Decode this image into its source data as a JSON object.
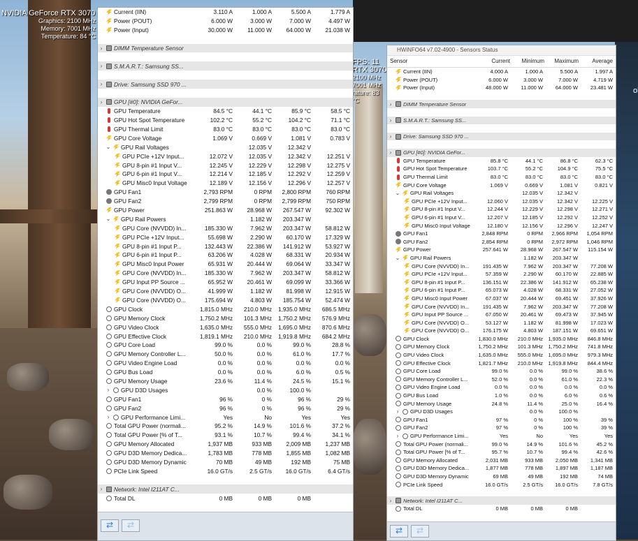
{
  "overlay": {
    "gpu_name": "NVIDIA GeForce RTX 3070",
    "graphics": "Graphics: 2100 MHz",
    "memory": "Memory: 7001 MHz",
    "temperature": "Temperature: 84 °C",
    "fps": "FPS: 11",
    "fps_gpu": "RTX 3070",
    "fps_line1": "2100 MHz",
    "fps_line2": "7001 MHz",
    "fps_line3": "rature: 83 °C",
    "right_text": "ol"
  },
  "win2": {
    "title": "HWiNFO64 v7.02-4900 - Sensors Status",
    "headers": [
      "Sensor",
      "Current",
      "Minimum",
      "Maximum",
      "Average"
    ]
  },
  "win1_rows": [
    {
      "t": "power",
      "n": "Current (IIN)",
      "c": "3.110 A",
      "mi": "1.000 A",
      "ma": "5.500 A",
      "av": "1.779 A"
    },
    {
      "t": "power",
      "n": "Power (POUT)",
      "c": "6.000 W",
      "mi": "3.000 W",
      "ma": "7.000 W",
      "av": "4.497 W"
    },
    {
      "t": "power",
      "n": "Power (Input)",
      "c": "30.000 W",
      "mi": "11.000 W",
      "ma": "64.000 W",
      "av": "21.038 W"
    },
    {
      "t": "gap"
    },
    {
      "t": "grp",
      "n": "DIMM Temperature Sensor"
    },
    {
      "t": "gap"
    },
    {
      "t": "grp",
      "n": "S.M.A.R.T.: Samsung SS..."
    },
    {
      "t": "gap"
    },
    {
      "t": "grp",
      "n": "Drive: Samsung SSD 970 ..."
    },
    {
      "t": "gap"
    },
    {
      "t": "grp",
      "n": "GPU [#0]: NVIDIA GeFor...",
      "open": true
    },
    {
      "t": "temp",
      "n": "GPU Temperature",
      "c": "84.5 °C",
      "mi": "44.1 °C",
      "ma": "85.9 °C",
      "av": "58.5 °C"
    },
    {
      "t": "temp",
      "n": "GPU Hot Spot Temperature",
      "c": "102.2 °C",
      "mi": "55.2 °C",
      "ma": "104.2 °C",
      "av": "71.1 °C"
    },
    {
      "t": "temp",
      "n": "GPU Thermal Limit",
      "c": "83.0 °C",
      "mi": "83.0 °C",
      "ma": "83.0 °C",
      "av": "83.0 °C"
    },
    {
      "t": "power",
      "n": "GPU Core Voltage",
      "c": "1.069 V",
      "mi": "0.669 V",
      "ma": "1.081 V",
      "av": "0.783 V"
    },
    {
      "t": "power",
      "n": "GPU Rail Voltages",
      "sub": 1,
      "tw": true,
      "c": "",
      "mi": "12.035 V",
      "ma": "12.342 V",
      "av": ""
    },
    {
      "t": "power",
      "n": "GPU PCIe +12V Input...",
      "sub": 2,
      "c": "12.072 V",
      "mi": "12.035 V",
      "ma": "12.342 V",
      "av": "12.251 V"
    },
    {
      "t": "power",
      "n": "GPU 8-pin #1 Input V...",
      "sub": 2,
      "c": "12.245 V",
      "mi": "12.229 V",
      "ma": "12.298 V",
      "av": "12.275 V"
    },
    {
      "t": "power",
      "n": "GPU 6-pin #1 Input V...",
      "sub": 2,
      "c": "12.214 V",
      "mi": "12.185 V",
      "ma": "12.292 V",
      "av": "12.259 V"
    },
    {
      "t": "power",
      "n": "GPU Misc0 Input Voltage",
      "sub": 2,
      "c": "12.189 V",
      "mi": "12.156 V",
      "ma": "12.296 V",
      "av": "12.257 V"
    },
    {
      "t": "fan",
      "n": "GPU Fan1",
      "c": "2,793 RPM",
      "mi": "0 RPM",
      "ma": "2,800 RPM",
      "av": "760 RPM"
    },
    {
      "t": "fan",
      "n": "GPU Fan2",
      "c": "2,799 RPM",
      "mi": "0 RPM",
      "ma": "2,799 RPM",
      "av": "750 RPM"
    },
    {
      "t": "power",
      "n": "GPU Power",
      "c": "251.863 W",
      "mi": "28.968 W",
      "ma": "267.547 W",
      "av": "92.302 W"
    },
    {
      "t": "power",
      "n": "GPU Rail Powers",
      "sub": 1,
      "tw": true,
      "c": "",
      "mi": "1.182 W",
      "ma": "203.347 W",
      "av": ""
    },
    {
      "t": "power",
      "n": "GPU Core (NVVDD) In...",
      "sub": 2,
      "c": "185.330 W",
      "mi": "7.962 W",
      "ma": "203.347 W",
      "av": "58.812 W"
    },
    {
      "t": "power",
      "n": "GPU PCIe +12V Input...",
      "sub": 2,
      "c": "55.698 W",
      "mi": "2.290 W",
      "ma": "60.170 W",
      "av": "17.329 W"
    },
    {
      "t": "power",
      "n": "GPU 8-pin #1 Input P...",
      "sub": 2,
      "c": "132.443 W",
      "mi": "22.386 W",
      "ma": "141.912 W",
      "av": "53.927 W"
    },
    {
      "t": "power",
      "n": "GPU 6-pin #1 Input P...",
      "sub": 2,
      "c": "63.206 W",
      "mi": "4.028 W",
      "ma": "68.331 W",
      "av": "20.934 W"
    },
    {
      "t": "power",
      "n": "GPU Misc0 Input Power",
      "sub": 2,
      "c": "65.931 W",
      "mi": "20.444 W",
      "ma": "69.064 W",
      "av": "33.347 W"
    },
    {
      "t": "power",
      "n": "GPU Core (NVVDD) In...",
      "sub": 2,
      "c": "185.330 W",
      "mi": "7.962 W",
      "ma": "203.347 W",
      "av": "58.812 W"
    },
    {
      "t": "power",
      "n": "GPU Input PP Source ...",
      "sub": 2,
      "c": "65.952 W",
      "mi": "20.461 W",
      "ma": "69.099 W",
      "av": "33.366 W"
    },
    {
      "t": "power",
      "n": "GPU Core (NVVDD) O...",
      "sub": 2,
      "c": "41.999 W",
      "mi": "1.182 W",
      "ma": "81.998 W",
      "av": "12.915 W"
    },
    {
      "t": "power",
      "n": "GPU Core (NVVDD) O...",
      "sub": 2,
      "c": "175.694 W",
      "mi": "4.803 W",
      "ma": "185.754 W",
      "av": "52.474 W"
    },
    {
      "t": "clock",
      "n": "GPU Clock",
      "c": "1,815.0 MHz",
      "mi": "210.0 MHz",
      "ma": "1,935.0 MHz",
      "av": "686.5 MHz"
    },
    {
      "t": "clock",
      "n": "GPU Memory Clock",
      "c": "1,750.2 MHz",
      "mi": "101.3 MHz",
      "ma": "1,750.2 MHz",
      "av": "576.9 MHz"
    },
    {
      "t": "clock",
      "n": "GPU Video Clock",
      "c": "1,635.0 MHz",
      "mi": "555.0 MHz",
      "ma": "1,695.0 MHz",
      "av": "870.6 MHz"
    },
    {
      "t": "clock",
      "n": "GPU Effective Clock",
      "c": "1,819.1 MHz",
      "mi": "210.0 MHz",
      "ma": "1,919.8 MHz",
      "av": "684.2 MHz"
    },
    {
      "t": "clock",
      "n": "GPU Core Load",
      "c": "99.0 %",
      "mi": "0.0 %",
      "ma": "99.0 %",
      "av": "28.8 %"
    },
    {
      "t": "clock",
      "n": "GPU Memory Controller L...",
      "c": "50.0 %",
      "mi": "0.0 %",
      "ma": "61.0 %",
      "av": "17.7 %"
    },
    {
      "t": "clock",
      "n": "GPU Video Engine Load",
      "c": "0.0 %",
      "mi": "0.0 %",
      "ma": "0.0 %",
      "av": "0.0 %"
    },
    {
      "t": "clock",
      "n": "GPU Bus Load",
      "c": "0.0 %",
      "mi": "0.0 %",
      "ma": "6.0 %",
      "av": "0.5 %"
    },
    {
      "t": "clock",
      "n": "GPU Memory Usage",
      "c": "23.6 %",
      "mi": "11.4 %",
      "ma": "24.5 %",
      "av": "15.1 %"
    },
    {
      "t": "clock",
      "n": "GPU D3D Usages",
      "tw": true,
      "twc": "›",
      "c": "",
      "mi": "0.0 %",
      "ma": "100.0 %",
      "av": ""
    },
    {
      "t": "clock",
      "n": "GPU Fan1",
      "c": "96 %",
      "mi": "0 %",
      "ma": "96 %",
      "av": "29 %"
    },
    {
      "t": "clock",
      "n": "GPU Fan2",
      "c": "96 %",
      "mi": "0 %",
      "ma": "96 %",
      "av": "29 %"
    },
    {
      "t": "clock",
      "n": "GPU Performance Limi...",
      "tw": true,
      "twc": "›",
      "c": "Yes",
      "mi": "No",
      "ma": "Yes",
      "av": "Yes"
    },
    {
      "t": "clock",
      "n": "Total GPU Power (normali...",
      "c": "95.2 %",
      "mi": "14.9 %",
      "ma": "101.6 %",
      "av": "37.2 %"
    },
    {
      "t": "clock",
      "n": "Total GPU Power [% of T...",
      "c": "93.1 %",
      "mi": "10.7 %",
      "ma": "99.4 %",
      "av": "34.1 %"
    },
    {
      "t": "clock",
      "n": "GPU Memory Allocated",
      "c": "1,937 MB",
      "mi": "933 MB",
      "ma": "2,009 MB",
      "av": "1,237 MB"
    },
    {
      "t": "clock",
      "n": "GPU D3D Memory Dedica...",
      "c": "1,783 MB",
      "mi": "778 MB",
      "ma": "1,855 MB",
      "av": "1,082 MB"
    },
    {
      "t": "clock",
      "n": "GPU D3D Memory Dynamic",
      "c": "70 MB",
      "mi": "49 MB",
      "ma": "192 MB",
      "av": "75 MB"
    },
    {
      "t": "clock",
      "n": "PCIe Link Speed",
      "c": "16.0 GT/s",
      "mi": "2.5 GT/s",
      "ma": "16.0 GT/s",
      "av": "6.4 GT/s"
    },
    {
      "t": "gap"
    },
    {
      "t": "grp",
      "n": "Network: Intel I211AT C...",
      "open": true
    },
    {
      "t": "clock",
      "n": "Total DL",
      "c": "0 MB",
      "mi": "0 MB",
      "ma": "0 MB",
      "av": ""
    }
  ],
  "win2_rows": [
    {
      "t": "power",
      "n": "Current (IIN)",
      "c": "4.000 A",
      "mi": "1.000 A",
      "ma": "5.500 A",
      "av": "1.997 A"
    },
    {
      "t": "power",
      "n": "Power (POUT)",
      "c": "6.000 W",
      "mi": "3.000 W",
      "ma": "7.000 W",
      "av": "4.719 W"
    },
    {
      "t": "power",
      "n": "Power (Input)",
      "c": "48.000 W",
      "mi": "11.000 W",
      "ma": "64.000 W",
      "av": "23.481 W"
    },
    {
      "t": "gap"
    },
    {
      "t": "grp",
      "n": "DIMM Temperature Sensor"
    },
    {
      "t": "gap"
    },
    {
      "t": "grp",
      "n": "S.M.A.R.T.: Samsung SS..."
    },
    {
      "t": "gap"
    },
    {
      "t": "grp",
      "n": "Drive: Samsung SSD 970 ..."
    },
    {
      "t": "gap"
    },
    {
      "t": "grp",
      "n": "GPU [#0]: NVIDIA GeFor...",
      "open": true
    },
    {
      "t": "temp",
      "n": "GPU Temperature",
      "c": "85.8 °C",
      "mi": "44.1 °C",
      "ma": "86.8 °C",
      "av": "62.3 °C"
    },
    {
      "t": "temp",
      "n": "GPU Hot Spot Temperature",
      "c": "103.7 °C",
      "mi": "55.2 °C",
      "ma": "104.9 °C",
      "av": "75.5 °C"
    },
    {
      "t": "temp",
      "n": "GPU Thermal Limit",
      "c": "83.0 °C",
      "mi": "83.0 °C",
      "ma": "83.0 °C",
      "av": "83.0 °C"
    },
    {
      "t": "power",
      "n": "GPU Core Voltage",
      "c": "1.069 V",
      "mi": "0.669 V",
      "ma": "1.081 V",
      "av": "0.821 V"
    },
    {
      "t": "power",
      "n": "GPU Rail Voltages",
      "sub": 1,
      "tw": true,
      "c": "",
      "mi": "12.035 V",
      "ma": "12.342 V",
      "av": ""
    },
    {
      "t": "power",
      "n": "GPU PCIe +12V Input...",
      "sub": 2,
      "c": "12.060 V",
      "mi": "12.035 V",
      "ma": "12.342 V",
      "av": "12.225 V"
    },
    {
      "t": "power",
      "n": "GPU 8-pin #1 Input V...",
      "sub": 2,
      "c": "12.244 V",
      "mi": "12.229 V",
      "ma": "12.298 V",
      "av": "12.271 V"
    },
    {
      "t": "power",
      "n": "GPU 6-pin #1 Input V...",
      "sub": 2,
      "c": "12.207 V",
      "mi": "12.185 V",
      "ma": "12.292 V",
      "av": "12.252 V"
    },
    {
      "t": "power",
      "n": "GPU Misc0 Input Voltage",
      "sub": 2,
      "c": "12.180 V",
      "mi": "12.156 V",
      "ma": "12.296 V",
      "av": "12.247 V"
    },
    {
      "t": "fan",
      "n": "GPU Fan1",
      "c": "2,848 RPM",
      "mi": "0 RPM",
      "ma": "2,966 RPM",
      "av": "1,054 RPM"
    },
    {
      "t": "fan",
      "n": "GPU Fan2",
      "c": "2,854 RPM",
      "mi": "0 RPM",
      "ma": "2,972 RPM",
      "av": "1,046 RPM"
    },
    {
      "t": "power",
      "n": "GPU Power",
      "c": "257.641 W",
      "mi": "28.968 W",
      "ma": "267.547 W",
      "av": "115.154 W"
    },
    {
      "t": "power",
      "n": "GPU Rail Powers",
      "sub": 1,
      "tw": true,
      "c": "",
      "mi": "1.182 W",
      "ma": "203.347 W",
      "av": ""
    },
    {
      "t": "power",
      "n": "GPU Core (NVVDD) In...",
      "sub": 2,
      "c": "191.435 W",
      "mi": "7.962 W",
      "ma": "203.347 W",
      "av": "77.208 W"
    },
    {
      "t": "power",
      "n": "GPU PCIe +12V Input...",
      "sub": 2,
      "c": "57.359 W",
      "mi": "2.290 W",
      "ma": "60.170 W",
      "av": "22.885 W"
    },
    {
      "t": "power",
      "n": "GPU 8-pin #1 Input P...",
      "sub": 2,
      "c": "136.151 W",
      "mi": "22.386 W",
      "ma": "141.912 W",
      "av": "65.238 W"
    },
    {
      "t": "power",
      "n": "GPU 6-pin #1 Input P...",
      "sub": 2,
      "c": "65.073 W",
      "mi": "4.028 W",
      "ma": "68.331 W",
      "av": "27.052 W"
    },
    {
      "t": "power",
      "n": "GPU Misc0 Input Power",
      "sub": 2,
      "c": "67.037 W",
      "mi": "20.444 W",
      "ma": "69.451 W",
      "av": "37.926 W"
    },
    {
      "t": "power",
      "n": "GPU Core (NVVDD) In...",
      "sub": 2,
      "c": "191.435 W",
      "mi": "7.962 W",
      "ma": "203.347 W",
      "av": "77.208 W"
    },
    {
      "t": "power",
      "n": "GPU Input PP Source ...",
      "sub": 2,
      "c": "67.050 W",
      "mi": "20.461 W",
      "ma": "69.473 W",
      "av": "37.945 W"
    },
    {
      "t": "power",
      "n": "GPU Core (NVVDD) O...",
      "sub": 2,
      "c": "53.127 W",
      "mi": "1.182 W",
      "ma": "81.998 W",
      "av": "17.023 W"
    },
    {
      "t": "power",
      "n": "GPU Core (NVVDD) O...",
      "sub": 2,
      "c": "176.175 W",
      "mi": "4.803 W",
      "ma": "187.151 W",
      "av": "69.651 W"
    },
    {
      "t": "clock",
      "n": "GPU Clock",
      "c": "1,830.0 MHz",
      "mi": "210.0 MHz",
      "ma": "1,935.0 MHz",
      "av": "846.8 MHz"
    },
    {
      "t": "clock",
      "n": "GPU Memory Clock",
      "c": "1,750.2 MHz",
      "mi": "101.3 MHz",
      "ma": "1,750.2 MHz",
      "av": "741.8 MHz"
    },
    {
      "t": "clock",
      "n": "GPU Video Clock",
      "c": "1,635.0 MHz",
      "mi": "555.0 MHz",
      "ma": "1,695.0 MHz",
      "av": "979.3 MHz"
    },
    {
      "t": "clock",
      "n": "GPU Effective Clock",
      "c": "1,821.7 MHz",
      "mi": "210.0 MHz",
      "ma": "1,919.8 MHz",
      "av": "844.4 MHz"
    },
    {
      "t": "clock",
      "n": "GPU Core Load",
      "c": "99.0 %",
      "mi": "0.0 %",
      "ma": "99.0 %",
      "av": "38.6 %"
    },
    {
      "t": "clock",
      "n": "GPU Memory Controller L...",
      "c": "52.0 %",
      "mi": "0.0 %",
      "ma": "61.0 %",
      "av": "22.3 %"
    },
    {
      "t": "clock",
      "n": "GPU Video Engine Load",
      "c": "0.0 %",
      "mi": "0.0 %",
      "ma": "0.0 %",
      "av": "0.0 %"
    },
    {
      "t": "clock",
      "n": "GPU Bus Load",
      "c": "1.0 %",
      "mi": "0.0 %",
      "ma": "6.0 %",
      "av": "0.6 %"
    },
    {
      "t": "clock",
      "n": "GPU Memory Usage",
      "c": "24.8 %",
      "mi": "11.4 %",
      "ma": "25.0 %",
      "av": "16.4 %"
    },
    {
      "t": "clock",
      "n": "GPU D3D Usages",
      "tw": true,
      "twc": "›",
      "c": "",
      "mi": "0.0 %",
      "ma": "100.0 %",
      "av": ""
    },
    {
      "t": "clock",
      "n": "GPU Fan1",
      "c": "97 %",
      "mi": "0 %",
      "ma": "100 %",
      "av": "39 %"
    },
    {
      "t": "clock",
      "n": "GPU Fan2",
      "c": "97 %",
      "mi": "0 %",
      "ma": "100 %",
      "av": "39 %"
    },
    {
      "t": "clock",
      "n": "GPU Performance Limi...",
      "tw": true,
      "twc": "›",
      "c": "Yes",
      "mi": "No",
      "ma": "Yes",
      "av": "Yes"
    },
    {
      "t": "clock",
      "n": "Total GPU Power (normali...",
      "c": "99.0 %",
      "mi": "14.9 %",
      "ma": "101.6 %",
      "av": "45.2 %"
    },
    {
      "t": "clock",
      "n": "Total GPU Power [% of T...",
      "c": "95.7 %",
      "mi": "10.7 %",
      "ma": "99.4 %",
      "av": "42.6 %"
    },
    {
      "t": "clock",
      "n": "GPU Memory Allocated",
      "c": "2,031 MB",
      "mi": "933 MB",
      "ma": "2,050 MB",
      "av": "1,341 MB"
    },
    {
      "t": "clock",
      "n": "GPU D3D Memory Dedica...",
      "c": "1,877 MB",
      "mi": "778 MB",
      "ma": "1,897 MB",
      "av": "1,187 MB"
    },
    {
      "t": "clock",
      "n": "GPU D3D Memory Dynamic",
      "c": "69 MB",
      "mi": "49 MB",
      "ma": "192 MB",
      "av": "74 MB"
    },
    {
      "t": "clock",
      "n": "PCIe Link Speed",
      "c": "16.0 GT/s",
      "mi": "2.5 GT/s",
      "ma": "16.0 GT/s",
      "av": "7.8 GT/s"
    },
    {
      "t": "gap"
    },
    {
      "t": "grp",
      "n": "Network: Intel I211AT C...",
      "open": true
    },
    {
      "t": "clock",
      "n": "Total DL",
      "c": "0 MB",
      "mi": "0 MB",
      "ma": "0 MB",
      "av": ""
    }
  ],
  "footer": {
    "nav_left": "⇄",
    "nav_right": "⇄"
  }
}
